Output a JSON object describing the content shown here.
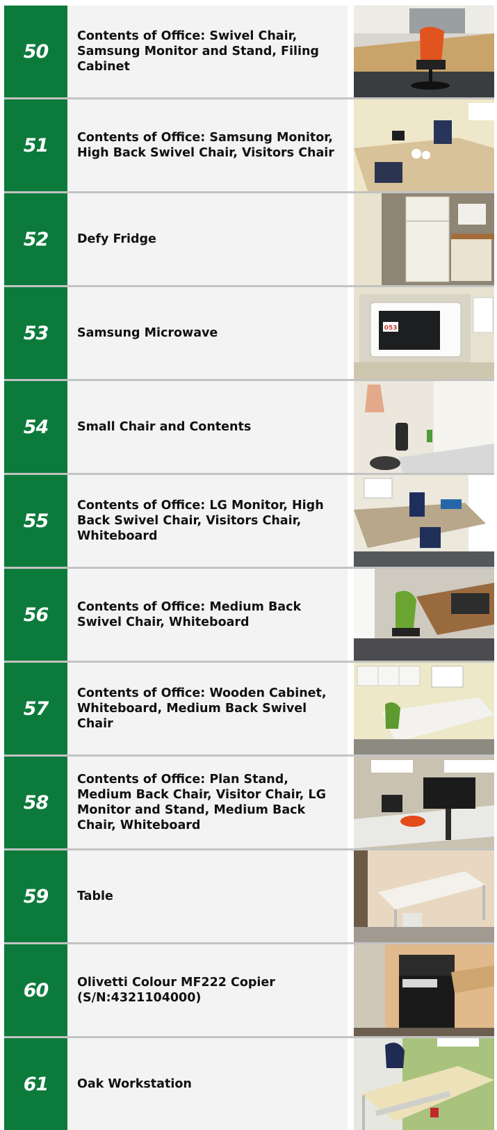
{
  "lots": [
    {
      "number": "50",
      "description": "Contents of Office: Swivel Chair, Samsung Monitor and Stand, Filing Cabinet",
      "photo_icon": "office-chair-photo"
    },
    {
      "number": "51",
      "description": "Contents of Office: Samsung Monitor, High Back Swivel Chair, Visitors Chair",
      "photo_icon": "office-desk-photo"
    },
    {
      "number": "52",
      "description": "Defy Fridge",
      "photo_icon": "fridge-photo"
    },
    {
      "number": "53",
      "description": "Samsung Microwave",
      "photo_icon": "microwave-photo",
      "photo_tag": "053"
    },
    {
      "number": "54",
      "description": "Small Chair and Contents",
      "photo_icon": "kitchen-corner-photo"
    },
    {
      "number": "55",
      "description": "Contents of Office: LG Monitor, High Back Swivel Chair, Visitors Chair, Whiteboard",
      "photo_icon": "office-desk-photo"
    },
    {
      "number": "56",
      "description": "Contents of Office: Medium Back Swivel Chair, Whiteboard",
      "photo_icon": "green-chair-photo"
    },
    {
      "number": "57",
      "description": "Contents of Office: Wooden Cabinet, Whiteboard, Medium Back Swivel Chair",
      "photo_icon": "office-cabinet-photo"
    },
    {
      "number": "58",
      "description": "Contents of Office: Plan Stand, Medium Back Chair, Visitor Chair, LG Monitor and Stand, Medium Back Chair, Whiteboard",
      "photo_icon": "monitor-stand-photo"
    },
    {
      "number": "59",
      "description": "Table",
      "photo_icon": "table-photo"
    },
    {
      "number": "60",
      "description": "Olivetti Colour MF222 Copier (S/N:4321104000)",
      "photo_icon": "copier-photo"
    },
    {
      "number": "61",
      "description": "Oak Workstation",
      "photo_icon": "workstation-photo"
    }
  ],
  "colors": {
    "lot_number_bg": "#0c7a3b",
    "description_bg": "#f3f3f3",
    "separator": "#c3c3c3"
  }
}
